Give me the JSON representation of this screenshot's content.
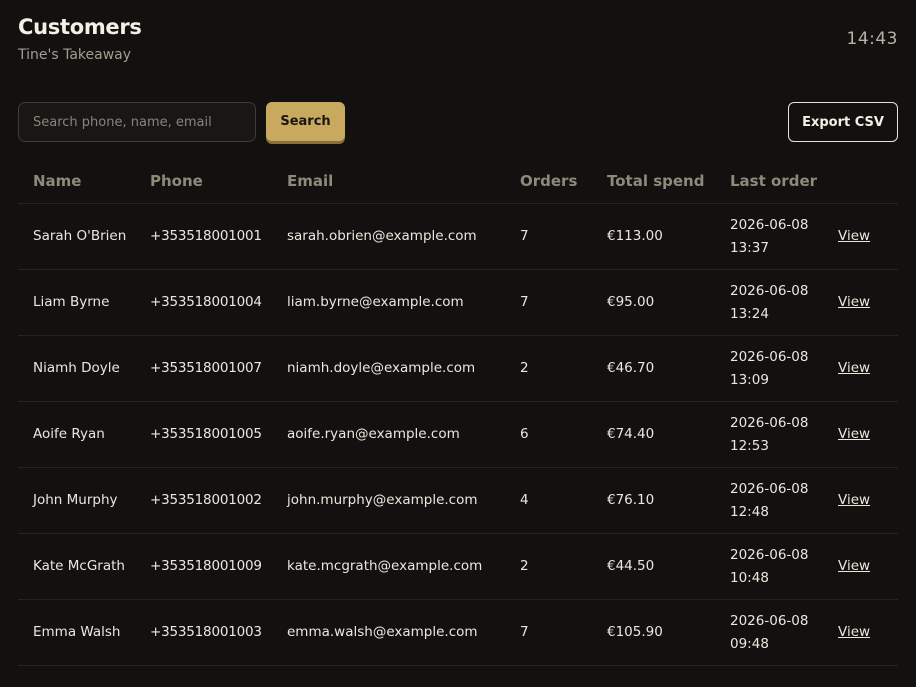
{
  "header": {
    "title": "Customers",
    "subtitle": "Tine's Takeaway",
    "clock": "14:43"
  },
  "toolbar": {
    "search_placeholder": "Search phone, name, email",
    "search_value": "",
    "search_label": "Search",
    "export_label": "Export CSV"
  },
  "table": {
    "columns": [
      "Name",
      "Phone",
      "Email",
      "Orders",
      "Total spend",
      "Last order",
      ""
    ],
    "view_label": "View",
    "rows": [
      {
        "name": "Sarah O'Brien",
        "phone": "+353518001001",
        "email": "sarah.obrien@example.com",
        "orders": "7",
        "total": "€113.00",
        "last_date": "2026-06-08",
        "last_time": "13:37"
      },
      {
        "name": "Liam Byrne",
        "phone": "+353518001004",
        "email": "liam.byrne@example.com",
        "orders": "7",
        "total": "€95.00",
        "last_date": "2026-06-08",
        "last_time": "13:24"
      },
      {
        "name": "Niamh Doyle",
        "phone": "+353518001007",
        "email": "niamh.doyle@example.com",
        "orders": "2",
        "total": "€46.70",
        "last_date": "2026-06-08",
        "last_time": "13:09"
      },
      {
        "name": "Aoife Ryan",
        "phone": "+353518001005",
        "email": "aoife.ryan@example.com",
        "orders": "6",
        "total": "€74.40",
        "last_date": "2026-06-08",
        "last_time": "12:53"
      },
      {
        "name": "John Murphy",
        "phone": "+353518001002",
        "email": "john.murphy@example.com",
        "orders": "4",
        "total": "€76.10",
        "last_date": "2026-06-08",
        "last_time": "12:48"
      },
      {
        "name": "Kate McGrath",
        "phone": "+353518001009",
        "email": "kate.mcgrath@example.com",
        "orders": "2",
        "total": "€44.50",
        "last_date": "2026-06-08",
        "last_time": "10:48"
      },
      {
        "name": "Emma Walsh",
        "phone": "+353518001003",
        "email": "emma.walsh@example.com",
        "orders": "7",
        "total": "€105.90",
        "last_date": "2026-06-08",
        "last_time": "09:48"
      }
    ]
  },
  "colors": {
    "background": "#121110",
    "accent": "#c9a95f",
    "text": "#ece7dc",
    "muted": "#8f897c"
  }
}
